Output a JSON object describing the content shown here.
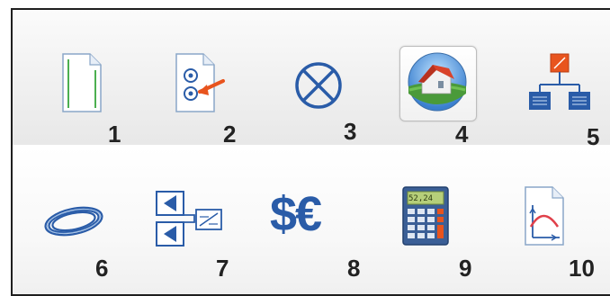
{
  "toolbar": {
    "row1": [
      {
        "label": "1",
        "icon": "blank-page-icon"
      },
      {
        "label": "2",
        "icon": "document-arrow-icon"
      },
      {
        "label": "3",
        "icon": "circle-x-icon"
      },
      {
        "label": "4",
        "icon": "house-globe-icon",
        "selected": true
      },
      {
        "label": "5",
        "icon": "hierarchy-tree-icon"
      }
    ],
    "row2": [
      {
        "label": "6",
        "icon": "cable-coil-icon"
      },
      {
        "label": "7",
        "icon": "transfer-boxes-icon"
      },
      {
        "label": "8",
        "icon": "currency-icon",
        "text": "$€"
      },
      {
        "label": "9",
        "icon": "calculator-icon",
        "display": "52,24"
      },
      {
        "label": "10",
        "icon": "curve-chart-icon"
      }
    ]
  },
  "colors": {
    "icon_blue": "#2a5ca8",
    "accent_orange": "#e8541e",
    "green": "#4caf50"
  }
}
